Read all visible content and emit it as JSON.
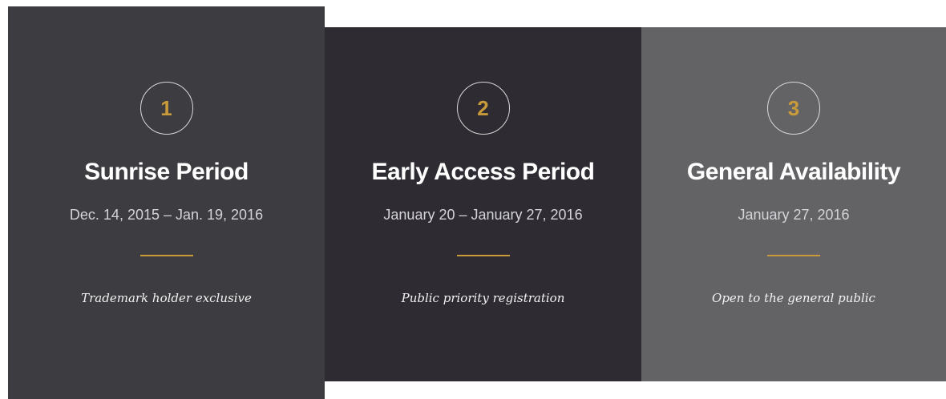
{
  "colors": {
    "accent": "#c99a3a",
    "panel_1_bg": "#3d3c41",
    "panel_2_bg": "#2e2c32",
    "panel_3_bg": "#636366"
  },
  "periods": [
    {
      "step": "1",
      "title": "Sunrise Period",
      "dates": "Dec. 14, 2015 – Jan. 19, 2016",
      "description": "Trademark holder exclusive"
    },
    {
      "step": "2",
      "title": "Early Access Period",
      "dates": "January 20 – January 27, 2016",
      "description": "Public priority registration"
    },
    {
      "step": "3",
      "title": "General Availability",
      "dates": "January 27, 2016",
      "description": "Open to the general public"
    }
  ]
}
